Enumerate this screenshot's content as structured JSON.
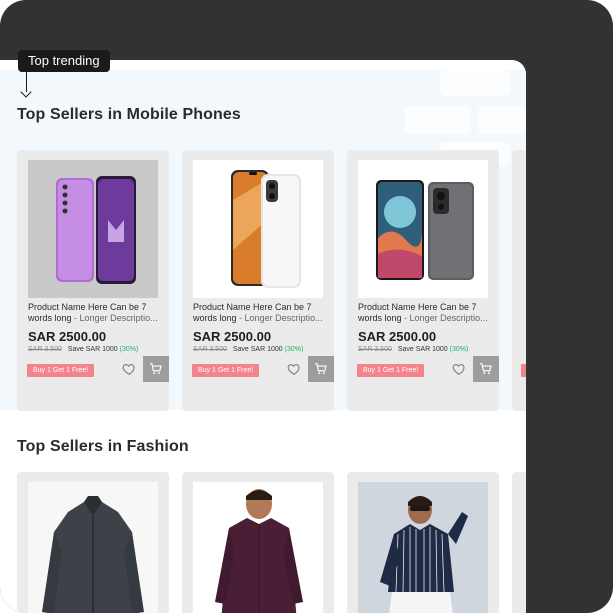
{
  "tag": {
    "label": "Top trending"
  },
  "sections": [
    {
      "title": "Top Sellers in Mobile Phones",
      "products": [
        {
          "name": "Product Name Here Can be 7 words long",
          "desc": "- Longer Descriptio...",
          "price": "SAR 2500.00",
          "old_price": "SAR 3.500",
          "save": "Save SAR 1000",
          "save_pct": "(30%)",
          "promo": "Buy 1 Get 1 Free!"
        },
        {
          "name": "Product Name Here Can be 7 words long",
          "desc": "- Longer Descriptio...",
          "price": "SAR 2500.00",
          "old_price": "SAR 3.500",
          "save": "Save SAR 1000",
          "save_pct": "(30%)",
          "promo": "Buy 1 Get 1 Free!"
        },
        {
          "name": "Product Name Here Can be 7 words long",
          "desc": "- Longer Descriptio...",
          "price": "SAR 2500.00",
          "old_price": "SAR 3.500",
          "save": "Save SAR 1000",
          "save_pct": "(30%)",
          "promo": "Buy 1 Get 1 Free!"
        }
      ]
    },
    {
      "title": "Top Sellers in Fashion"
    }
  ],
  "colors": {
    "frame": "#323232",
    "band": "#f3f8fd",
    "promo": "#f2858c",
    "save_pct": "#1eb36a",
    "cart_button": "#9d9d9d"
  },
  "icons": [
    "heart-icon",
    "cart-icon",
    "arrow-down-icon"
  ]
}
